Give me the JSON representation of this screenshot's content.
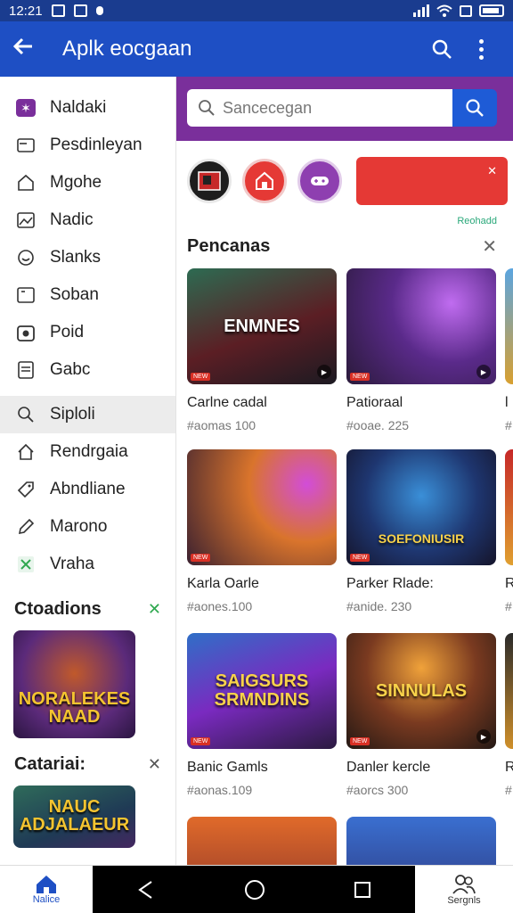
{
  "status": {
    "time": "12:21"
  },
  "appbar": {
    "title": "Aplk eocgaan"
  },
  "drawer": {
    "items": [
      {
        "label": "Naldaki",
        "icon": "star-badge-icon"
      },
      {
        "label": "Pesdinleyan",
        "icon": "mail-icon"
      },
      {
        "label": "Mgohe",
        "icon": "home-icon"
      },
      {
        "label": "Nadic",
        "icon": "image-icon"
      },
      {
        "label": "Slanks",
        "icon": "smile-icon"
      },
      {
        "label": "Soban",
        "icon": "folder-icon"
      },
      {
        "label": "Poid",
        "icon": "camera-icon"
      },
      {
        "label": "Gabc",
        "icon": "document-icon"
      },
      {
        "label": "Siploli",
        "icon": "search-icon"
      },
      {
        "label": "Rendrgaia",
        "icon": "house-icon"
      },
      {
        "label": "Abndliane",
        "icon": "tag-icon"
      },
      {
        "label": "Marono",
        "icon": "pencil-icon"
      },
      {
        "label": "Vraha",
        "icon": "x-tile-icon"
      }
    ],
    "section1": {
      "title": "Ctoadions",
      "thumb_label": "NORALEKES NAAD"
    },
    "section2": {
      "title": "Catariai:",
      "thumb_label": "NAUC ADJALAEUR"
    }
  },
  "search": {
    "placeholder": "Sancecegan"
  },
  "small_link": "Reohadd",
  "section": {
    "title": "Pencanas"
  },
  "cards": [
    {
      "title": "Carlne cadal",
      "sub": "#aomas 100",
      "art": "ENMNES",
      "tag": "NEW"
    },
    {
      "title": "Patioraal",
      "sub": "#ooae. 225",
      "art": "",
      "tag": "NEW"
    },
    {
      "title": "Karla Oarle",
      "sub": "#aones.100",
      "art": "",
      "tag": "NEW"
    },
    {
      "title": "Parker Rlade:",
      "sub": "#anide. 230",
      "art": "SOEFONIUSIR",
      "tag": "NEW"
    },
    {
      "title": "Banic Gamls",
      "sub": "#aonas.109",
      "art": "SAIGSURS SRMNDINS",
      "tag": "NEW"
    },
    {
      "title": "Danler kercle",
      "sub": "#aorcs 300",
      "art": "SINNULAS",
      "tag": "NEW"
    },
    {
      "title": "",
      "sub": "",
      "art": "",
      "tag": ""
    },
    {
      "title": "",
      "sub": "",
      "art": "",
      "tag": ""
    }
  ],
  "peek": {
    "t1": "l",
    "s1": "#",
    "t2": "R",
    "s2": "#",
    "t3": "R",
    "s3": "#"
  },
  "bottom": {
    "left_label": "Nalice",
    "right_label": "Sergnls"
  },
  "colors": {
    "appbar": "#1e4fc4",
    "search_band": "#7a2f9b",
    "accent": "#e53935"
  }
}
